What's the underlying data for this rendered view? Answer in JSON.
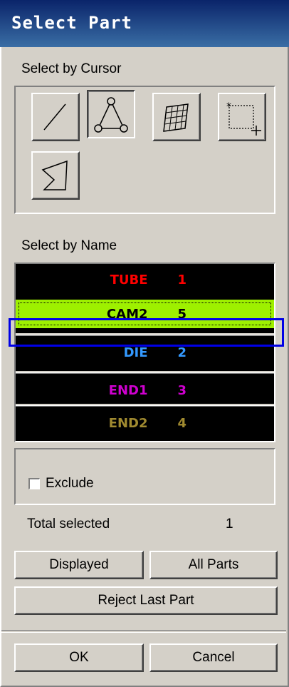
{
  "window": {
    "title": "Select Part"
  },
  "cursor_section": {
    "label": "Select by Cursor",
    "tools": [
      {
        "name": "line-select-tool",
        "pressed": false
      },
      {
        "name": "polygon-select-tool",
        "pressed": true
      },
      {
        "name": "surface-select-tool",
        "pressed": false
      },
      {
        "name": "box-select-tool",
        "pressed": false
      },
      {
        "name": "freehand-area-select-tool",
        "pressed": false
      }
    ]
  },
  "name_section": {
    "label": "Select by Name",
    "parts": [
      {
        "name": "TUBE",
        "id": "1",
        "color": "#ff0000",
        "selected": false
      },
      {
        "name": "CAM2",
        "id": "5",
        "color": "#000000",
        "selected": true
      },
      {
        "name": "DIE",
        "id": "2",
        "color": "#3399ff",
        "selected": false
      },
      {
        "name": "END1",
        "id": "3",
        "color": "#d000d0",
        "selected": false
      },
      {
        "name": "END2",
        "id": "4",
        "color": "#a08a30",
        "selected": false
      }
    ]
  },
  "exclude": {
    "label": "Exclude",
    "checked": false
  },
  "total": {
    "label": "Total selected",
    "value": "1"
  },
  "buttons": {
    "displayed": "Displayed",
    "all_parts": "All Parts",
    "reject_last": "Reject Last Part",
    "ok": "OK",
    "cancel": "Cancel"
  },
  "colors": {
    "selected_row": "#9ef000",
    "highlight_border": "#0000e6",
    "list_background": "#000000"
  }
}
